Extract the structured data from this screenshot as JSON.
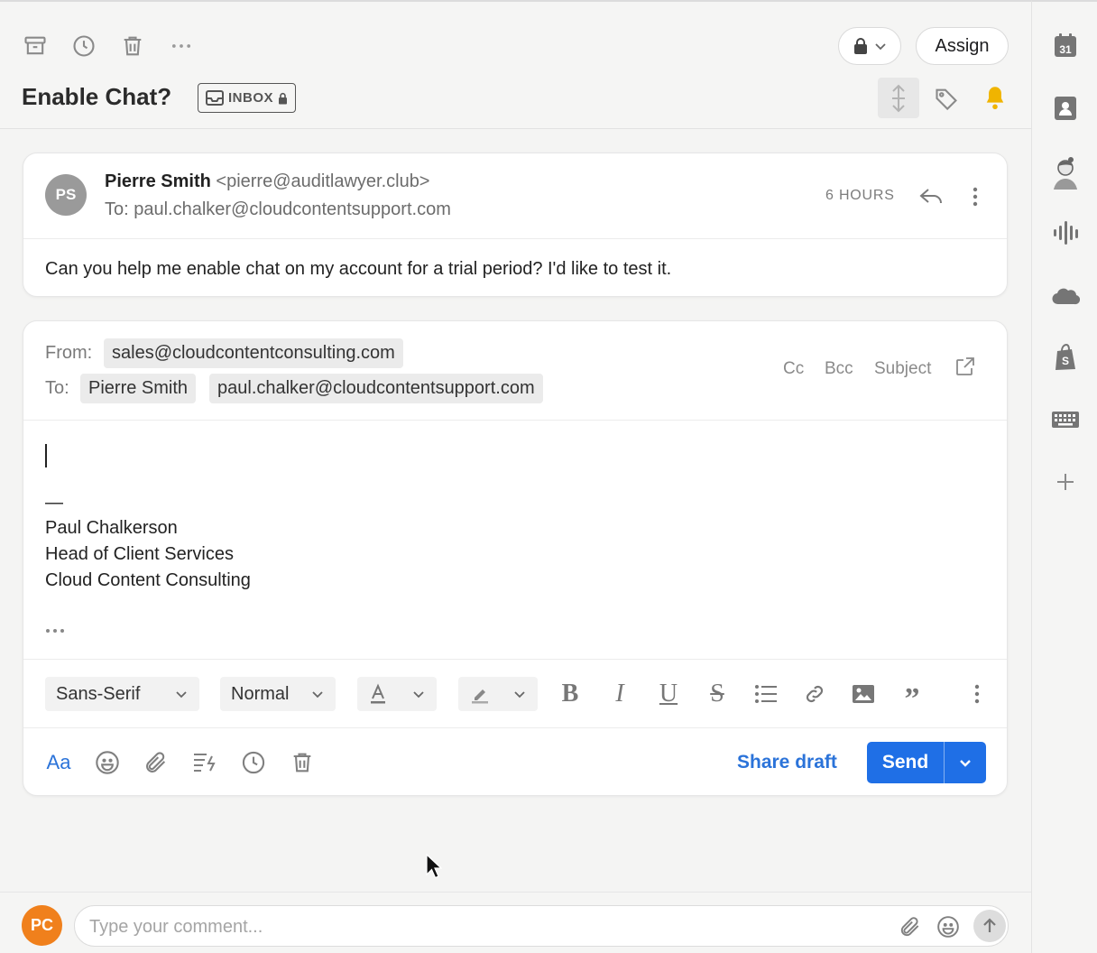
{
  "toolbar": {
    "icons": [
      "archive-icon",
      "snooze-clock-icon",
      "trash-icon",
      "more-horizontal-icon"
    ],
    "assign_label": "Assign"
  },
  "conversation": {
    "title": "Enable Chat?",
    "inbox_tag": "INBOX"
  },
  "message": {
    "avatar_initials": "PS",
    "sender_name": "Pierre Smith",
    "sender_email": "<pierre@auditlawyer.club>",
    "to_line": "To: paul.chalker@cloudcontentsupport.com",
    "time": "6 HOURS",
    "body": "Can you help me enable chat on my account for a trial period? I'd like to test it."
  },
  "compose": {
    "from_label": "From:",
    "from_value": "sales@cloudcontentconsulting.com",
    "to_label": "To:",
    "to_recipients": [
      "Pierre Smith",
      "paul.chalker@cloudcontentsupport.com"
    ],
    "cc_label": "Cc",
    "bcc_label": "Bcc",
    "subject_label": "Subject",
    "signature_dash": "—",
    "signature_lines": [
      "Paul Chalkerson",
      "Head of Client Services",
      "Cloud Content Consulting"
    ],
    "font_family_value": "Sans-Serif",
    "font_size_value": "Normal",
    "share_draft_label": "Share draft",
    "send_label": "Send"
  },
  "comment": {
    "avatar_initials": "PC",
    "placeholder": "Type your comment..."
  },
  "rail": {
    "calendar_day": "31",
    "icons": [
      "calendar-icon",
      "contact-card-icon",
      "avatar-illustration-icon",
      "audio-waveform-icon",
      "salesforce-cloud-icon",
      "shopify-bag-icon",
      "keyboard-icon",
      "add-integration-icon"
    ]
  },
  "colors": {
    "accent": "#1f6fe6",
    "link": "#2b73d9",
    "bell": "#f0b400",
    "comment_avatar": "#f0801c"
  }
}
